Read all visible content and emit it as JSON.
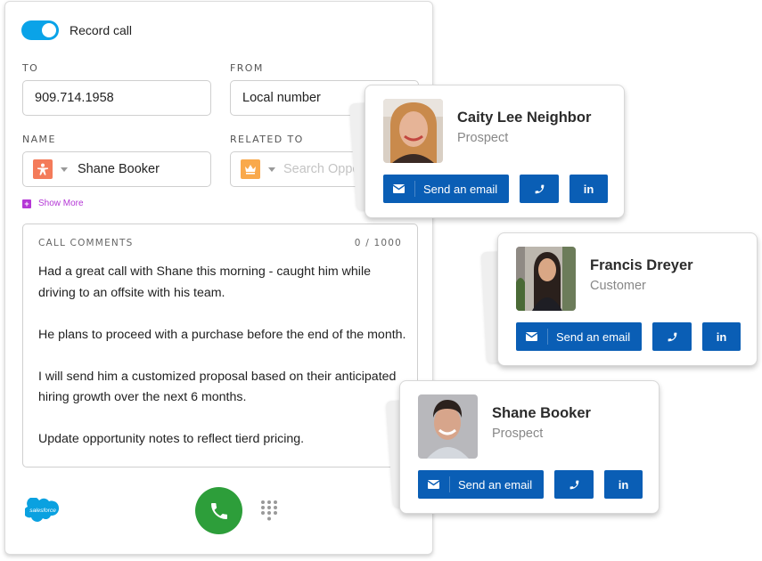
{
  "dialer": {
    "record_toggle": {
      "label": "Record call",
      "on": true
    },
    "to": {
      "label": "TO",
      "value": "909.714.1958"
    },
    "from": {
      "label": "FROM",
      "value": "Local number"
    },
    "name": {
      "label": "NAME",
      "value": "Shane Booker",
      "icon": "person-icon"
    },
    "related_to": {
      "label": "RELATED TO",
      "placeholder": "Search Opport",
      "icon": "crown-icon"
    },
    "show_more": "Show More",
    "comments": {
      "label": "CALL COMMENTS",
      "counter": "0 / 1000",
      "paragraphs": [
        "Had a great call with Shane this morning - caught him while driving to an offsite with his team.",
        "He plans to proceed with a purchase before the end of the month.",
        "I will send him a customized proposal based on their anticipated hiring growth over the next 6 months.",
        "Update opportunity notes to reflect tierd pricing."
      ]
    },
    "salesforce_logo_text": "salesforce",
    "colors": {
      "toggle": "#0aa3e8",
      "call": "#2d9e3a",
      "person_badge": "#f47b5a",
      "crown_badge": "#f9a94b",
      "show_more": "#b437d6"
    }
  },
  "contacts": [
    {
      "name": "Caity Lee Neighbor",
      "role": "Prospect",
      "email_label": "Send an email"
    },
    {
      "name": "Francis Dreyer",
      "role": "Customer",
      "email_label": "Send an email"
    },
    {
      "name": "Shane Booker",
      "role": "Prospect",
      "email_label": "Send an email"
    }
  ],
  "button_color": "#0a5eb5",
  "linkedin_label": "in"
}
